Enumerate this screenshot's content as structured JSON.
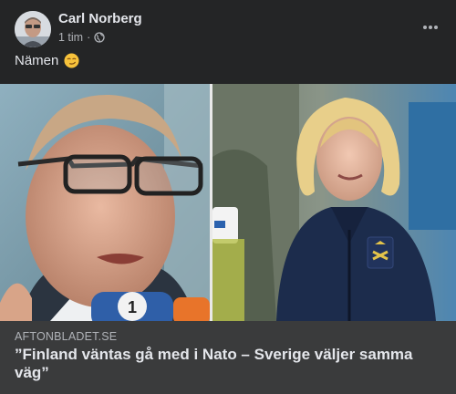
{
  "post": {
    "author": "Carl Norberg",
    "time": "1 tim",
    "privacy_icon": "globe-icon",
    "text": "Nämen",
    "emoji": "smirking-face-emoji",
    "more_icon": "more-options-icon"
  },
  "link_preview": {
    "domain": "AFTONBLADET.SE",
    "headline": "”Finland väntas gå med i Nato – Sverige väljer samma väg”"
  },
  "colors": {
    "background": "#242526",
    "link_card": "#3a3b3c",
    "primary_text": "#e4e6eb",
    "secondary_text": "#b0b3b8"
  }
}
